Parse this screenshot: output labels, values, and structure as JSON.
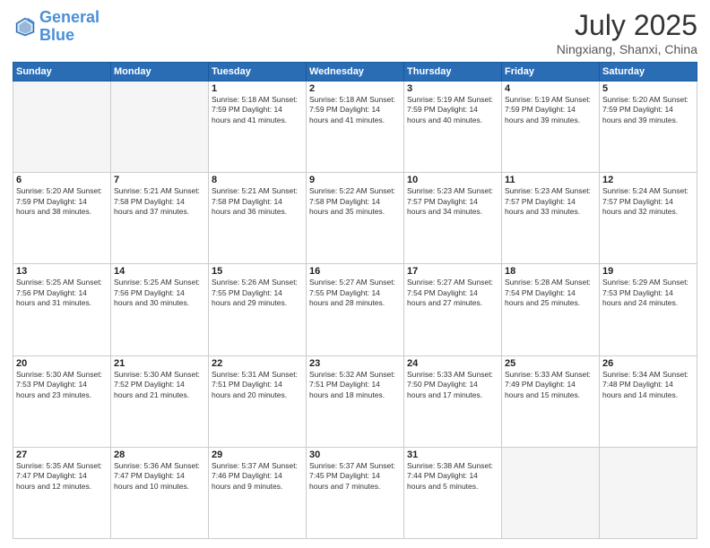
{
  "header": {
    "logo_line1": "General",
    "logo_line2": "Blue",
    "main_title": "July 2025",
    "subtitle": "Ningxiang, Shanxi, China"
  },
  "days_of_week": [
    "Sunday",
    "Monday",
    "Tuesday",
    "Wednesday",
    "Thursday",
    "Friday",
    "Saturday"
  ],
  "weeks": [
    [
      {
        "day": "",
        "info": ""
      },
      {
        "day": "",
        "info": ""
      },
      {
        "day": "1",
        "info": "Sunrise: 5:18 AM\nSunset: 7:59 PM\nDaylight: 14 hours and 41 minutes."
      },
      {
        "day": "2",
        "info": "Sunrise: 5:18 AM\nSunset: 7:59 PM\nDaylight: 14 hours and 41 minutes."
      },
      {
        "day": "3",
        "info": "Sunrise: 5:19 AM\nSunset: 7:59 PM\nDaylight: 14 hours and 40 minutes."
      },
      {
        "day": "4",
        "info": "Sunrise: 5:19 AM\nSunset: 7:59 PM\nDaylight: 14 hours and 39 minutes."
      },
      {
        "day": "5",
        "info": "Sunrise: 5:20 AM\nSunset: 7:59 PM\nDaylight: 14 hours and 39 minutes."
      }
    ],
    [
      {
        "day": "6",
        "info": "Sunrise: 5:20 AM\nSunset: 7:59 PM\nDaylight: 14 hours and 38 minutes."
      },
      {
        "day": "7",
        "info": "Sunrise: 5:21 AM\nSunset: 7:58 PM\nDaylight: 14 hours and 37 minutes."
      },
      {
        "day": "8",
        "info": "Sunrise: 5:21 AM\nSunset: 7:58 PM\nDaylight: 14 hours and 36 minutes."
      },
      {
        "day": "9",
        "info": "Sunrise: 5:22 AM\nSunset: 7:58 PM\nDaylight: 14 hours and 35 minutes."
      },
      {
        "day": "10",
        "info": "Sunrise: 5:23 AM\nSunset: 7:57 PM\nDaylight: 14 hours and 34 minutes."
      },
      {
        "day": "11",
        "info": "Sunrise: 5:23 AM\nSunset: 7:57 PM\nDaylight: 14 hours and 33 minutes."
      },
      {
        "day": "12",
        "info": "Sunrise: 5:24 AM\nSunset: 7:57 PM\nDaylight: 14 hours and 32 minutes."
      }
    ],
    [
      {
        "day": "13",
        "info": "Sunrise: 5:25 AM\nSunset: 7:56 PM\nDaylight: 14 hours and 31 minutes."
      },
      {
        "day": "14",
        "info": "Sunrise: 5:25 AM\nSunset: 7:56 PM\nDaylight: 14 hours and 30 minutes."
      },
      {
        "day": "15",
        "info": "Sunrise: 5:26 AM\nSunset: 7:55 PM\nDaylight: 14 hours and 29 minutes."
      },
      {
        "day": "16",
        "info": "Sunrise: 5:27 AM\nSunset: 7:55 PM\nDaylight: 14 hours and 28 minutes."
      },
      {
        "day": "17",
        "info": "Sunrise: 5:27 AM\nSunset: 7:54 PM\nDaylight: 14 hours and 27 minutes."
      },
      {
        "day": "18",
        "info": "Sunrise: 5:28 AM\nSunset: 7:54 PM\nDaylight: 14 hours and 25 minutes."
      },
      {
        "day": "19",
        "info": "Sunrise: 5:29 AM\nSunset: 7:53 PM\nDaylight: 14 hours and 24 minutes."
      }
    ],
    [
      {
        "day": "20",
        "info": "Sunrise: 5:30 AM\nSunset: 7:53 PM\nDaylight: 14 hours and 23 minutes."
      },
      {
        "day": "21",
        "info": "Sunrise: 5:30 AM\nSunset: 7:52 PM\nDaylight: 14 hours and 21 minutes."
      },
      {
        "day": "22",
        "info": "Sunrise: 5:31 AM\nSunset: 7:51 PM\nDaylight: 14 hours and 20 minutes."
      },
      {
        "day": "23",
        "info": "Sunrise: 5:32 AM\nSunset: 7:51 PM\nDaylight: 14 hours and 18 minutes."
      },
      {
        "day": "24",
        "info": "Sunrise: 5:33 AM\nSunset: 7:50 PM\nDaylight: 14 hours and 17 minutes."
      },
      {
        "day": "25",
        "info": "Sunrise: 5:33 AM\nSunset: 7:49 PM\nDaylight: 14 hours and 15 minutes."
      },
      {
        "day": "26",
        "info": "Sunrise: 5:34 AM\nSunset: 7:48 PM\nDaylight: 14 hours and 14 minutes."
      }
    ],
    [
      {
        "day": "27",
        "info": "Sunrise: 5:35 AM\nSunset: 7:47 PM\nDaylight: 14 hours and 12 minutes."
      },
      {
        "day": "28",
        "info": "Sunrise: 5:36 AM\nSunset: 7:47 PM\nDaylight: 14 hours and 10 minutes."
      },
      {
        "day": "29",
        "info": "Sunrise: 5:37 AM\nSunset: 7:46 PM\nDaylight: 14 hours and 9 minutes."
      },
      {
        "day": "30",
        "info": "Sunrise: 5:37 AM\nSunset: 7:45 PM\nDaylight: 14 hours and 7 minutes."
      },
      {
        "day": "31",
        "info": "Sunrise: 5:38 AM\nSunset: 7:44 PM\nDaylight: 14 hours and 5 minutes."
      },
      {
        "day": "",
        "info": ""
      },
      {
        "day": "",
        "info": ""
      }
    ]
  ]
}
